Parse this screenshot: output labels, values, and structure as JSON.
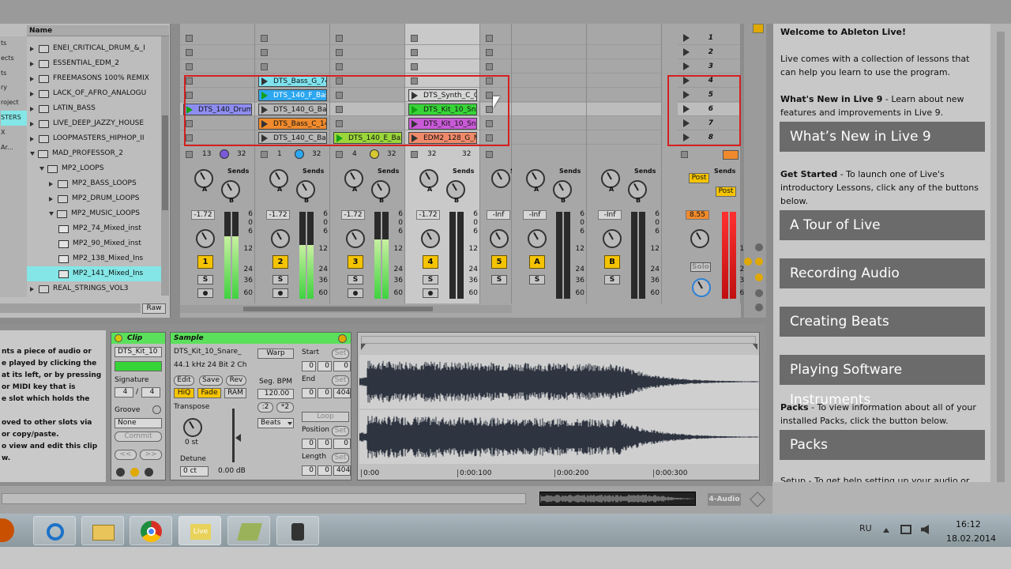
{
  "browser": {
    "header": "Name",
    "left_labels": [
      "ts",
      "ects",
      "ts",
      "",
      "",
      "",
      "",
      "",
      "",
      "ry",
      "roject",
      "STERS",
      "X",
      "Ar...",
      "",
      ""
    ],
    "items": [
      {
        "label": "ENEI_CRITICAL_DRUM_&_I",
        "indent": 0,
        "kind": "folder",
        "open": false
      },
      {
        "label": "ESSENTIAL_EDM_2",
        "indent": 0,
        "kind": "folder",
        "open": false
      },
      {
        "label": "FREEMASONS 100% REMIX",
        "indent": 0,
        "kind": "folder",
        "open": false
      },
      {
        "label": "LACK_OF_AFRO_ANALOGU",
        "indent": 0,
        "kind": "folder",
        "open": false
      },
      {
        "label": "LATIN_BASS",
        "indent": 0,
        "kind": "folder",
        "open": false
      },
      {
        "label": "LIVE_DEEP_JAZZY_HOUSE",
        "indent": 0,
        "kind": "folder",
        "open": false
      },
      {
        "label": "LOOPMASTERS_HIPHOP_II",
        "indent": 0,
        "kind": "folder",
        "open": false
      },
      {
        "label": "MAD_PROFESSOR_2",
        "indent": 0,
        "kind": "folder",
        "open": true
      },
      {
        "label": "MP2_LOOPS",
        "indent": 1,
        "kind": "folder",
        "open": true
      },
      {
        "label": "MP2_BASS_LOOPS",
        "indent": 2,
        "kind": "folder",
        "open": false
      },
      {
        "label": "MP2_DRUM_LOOPS",
        "indent": 2,
        "kind": "folder",
        "open": false
      },
      {
        "label": "MP2_MUSIC_LOOPS",
        "indent": 2,
        "kind": "folder",
        "open": true
      },
      {
        "label": "MP2_74_Mixed_inst",
        "indent": 3,
        "kind": "file",
        "open": false
      },
      {
        "label": "MP2_90_Mixed_inst",
        "indent": 3,
        "kind": "file",
        "open": false
      },
      {
        "label": "MP2_138_Mixed_Ins",
        "indent": 3,
        "kind": "file",
        "open": false
      },
      {
        "label": "MP2_141_Mixed_Ins",
        "indent": 3,
        "kind": "file",
        "open": false,
        "selected": true
      },
      {
        "label": "REAL_STRINGS_VOL3",
        "indent": 0,
        "kind": "folder",
        "open": false
      }
    ],
    "raw_button": "Raw"
  },
  "session": {
    "scenes": [
      "1",
      "2",
      "3",
      "4",
      "5",
      "6",
      "7",
      "8"
    ],
    "tracks": [
      {
        "clips": [
          null,
          null,
          null,
          null,
          null,
          {
            "name": "DTS_140_Drum",
            "color": "#8d8df0",
            "playing": true
          },
          null,
          null
        ],
        "num": "1",
        "scene_count": "13",
        "sends_label": "Sends",
        "vol": "-1.72",
        "meter": 0.72
      },
      {
        "clips": [
          null,
          null,
          null,
          {
            "name": "DTS_Bass_G_74",
            "color": "#7fe3ee"
          },
          {
            "name": "DTS_140_F_Bas",
            "color": "#2ca7f0",
            "playing": true
          },
          {
            "name": "DTS_140_G_Bas",
            "color": "#b7b7b7"
          },
          {
            "name": "DTS_Bass_C_14",
            "color": "#f08a2c"
          },
          {
            "name": "DTS_140_C_Bas",
            "color": "#b7b7b7"
          }
        ],
        "num": "2",
        "scene_count": "1",
        "sends_label": "Sends",
        "vol": "-1.72",
        "meter": 0.62
      },
      {
        "clips": [
          null,
          null,
          null,
          null,
          null,
          null,
          null,
          {
            "name": "DTS_140_E_Bas",
            "color": "#9ad63a",
            "playing": true
          }
        ],
        "num": "3",
        "scene_count": "4",
        "sends_label": "Sends",
        "vol": "-1.72",
        "meter": 0.68
      },
      {
        "clips": [
          null,
          null,
          null,
          null,
          {
            "name": "DTS_Synth_C_0",
            "color": "#d6d6d6"
          },
          {
            "name": "DTS_Kit_10_Sn",
            "color": "#37d437",
            "playing": true
          },
          {
            "name": "DTS_Kit_10_Sn",
            "color": "#c85ad6"
          },
          {
            "name": "EDM2_128_G_M",
            "color": "#f08a6a"
          }
        ],
        "num": "4",
        "scene_count": "32",
        "sends_label": "Sends",
        "vol": "-1.72",
        "meter": 0.0
      },
      {
        "clips": [
          null,
          null,
          null,
          null,
          null,
          null,
          null,
          null
        ],
        "num": "5",
        "scene_count": "",
        "sends_label": "Sends",
        "vol": "-Inf",
        "meter": 0.0
      },
      {
        "clips": [],
        "num": "A",
        "scene_count": "",
        "sends_label": "Sends",
        "vol": "-Inf",
        "meter": 0.0
      },
      {
        "clips": [],
        "num": "B",
        "scene_count": "",
        "sends_label": "Sends",
        "vol": "-Inf",
        "meter": 0.0
      }
    ],
    "master": {
      "sends_label": "Sends",
      "post1": "Post",
      "post2": "Post",
      "vol": "8.55",
      "solo": "Solo"
    },
    "scale": [
      "6",
      "0",
      "6",
      "12",
      "24",
      "36",
      "60"
    ],
    "sends_a": "A",
    "sends_b": "B",
    "solo_label": "S"
  },
  "detail": {
    "left_help": [
      "nts a piece of audio or",
      "e played by clicking the",
      "at its left, or by pressing",
      "or MIDI key that is",
      "e slot which holds the",
      "",
      "oved to other slots via",
      "or copy/paste.",
      "o view and edit this clip",
      "w."
    ],
    "clip": {
      "title": "Clip",
      "name": "DTS_Kit_10",
      "signature_label": "Signature",
      "sig_num": "4",
      "sig_den": "4",
      "groove_label": "Groove",
      "groove_value": "None",
      "commit": "Commit"
    },
    "sample": {
      "title": "Sample",
      "file": "DTS_Kit_10_Snare_",
      "info": "44.1 kHz 24 Bit 2 Ch",
      "edit": "Edit",
      "save": "Save",
      "rev": "Rev",
      "hiq": "HiQ",
      "fade": "Fade",
      "ram": "RAM",
      "transpose": "Transpose",
      "semi": "0 st",
      "detune": "Detune",
      "detune_val": "0 ct",
      "gain": "0.00 dB",
      "warp": "Warp",
      "segbpm_label": "Seg. BPM",
      "segbpm": "120.00",
      "half": ":2",
      "double": "*2",
      "mode": "Beats",
      "start": "Start",
      "end": "End",
      "loop": "Loop",
      "position": "Position",
      "length": "Length",
      "set": "Set",
      "start_vals": [
        "0",
        "0",
        "0"
      ],
      "end_vals": [
        "0",
        "0",
        "404"
      ],
      "pos_vals": [
        "0",
        "0",
        "0"
      ],
      "len_vals": [
        "0",
        "0",
        "404"
      ]
    },
    "timeline": [
      "0:00",
      "0:00:100",
      "0:00:200",
      "0:00:300"
    ]
  },
  "help": {
    "title": "Welcome to Ableton Live!",
    "p1": "Live comes with a collection of lessons that can help you learn to use the program.",
    "p2_bold": "What's New in Live 9",
    "p2": " - Learn about new features and improvements in Live 9.",
    "btn1": "What’s New in Live 9",
    "p3_bold": "Get Started",
    "p3": " - To launch one of Live's introductory Lessons, click any of the buttons below.",
    "btn2": "A Tour of Live",
    "btn3": "Recording Audio",
    "btn4": "Creating Beats",
    "btn5": "Playing Software Instruments",
    "p4_bold": "Packs",
    "p4": " - To view information about all of your installed Packs, click the button below.",
    "btn6": "Packs",
    "p5": "Setup - To get help setting up your audio or"
  },
  "status": {
    "track_label": "4-Audio"
  },
  "taskbar": {
    "lang": "RU",
    "time": "16:12",
    "date": "18.02.2014",
    "live": "Live"
  },
  "colors": {
    "accent_green": "#5be05b",
    "record_red": "#e02020",
    "yellow": "#f5c400"
  }
}
